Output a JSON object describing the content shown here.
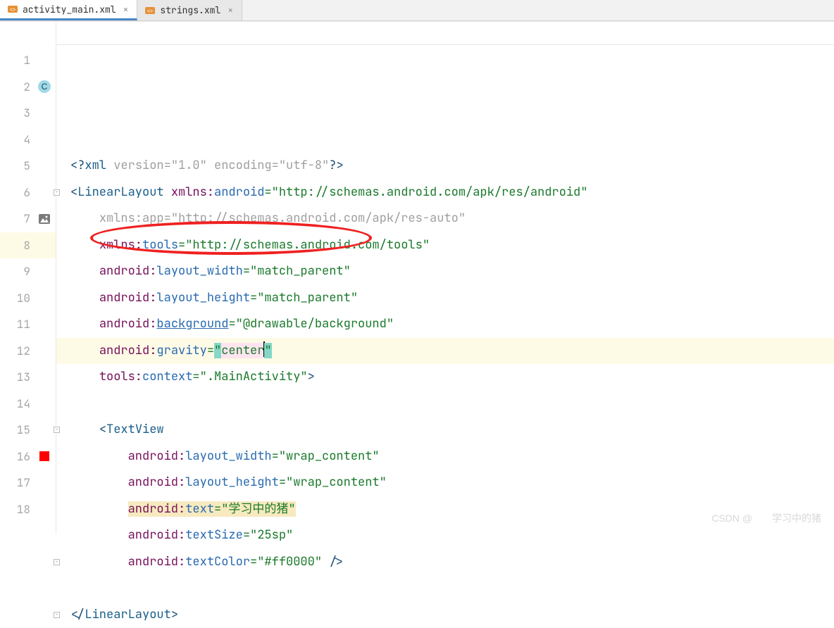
{
  "tabs": [
    {
      "label": "activity_main.xml",
      "active": true
    },
    {
      "label": "strings.xml",
      "active": false
    }
  ],
  "gutter": {
    "line_numbers": [
      "1",
      "2",
      "3",
      "4",
      "5",
      "6",
      "7",
      "8",
      "9",
      "10",
      "11",
      "12",
      "13",
      "14",
      "15",
      "16",
      "17",
      "18"
    ],
    "highlighted_line": 8,
    "icons": {
      "2": {
        "type": "circle-letter",
        "letter": "C",
        "bg": "#9fd9e8",
        "fg": "#245"
      },
      "7": {
        "type": "image-icon"
      },
      "16": {
        "type": "red-square"
      }
    }
  },
  "code": {
    "lines": [
      {
        "n": 1,
        "tokens": [
          {
            "t": "<?",
            "cls": "c-dark"
          },
          {
            "t": "xml ",
            "cls": "c-tag"
          },
          {
            "t": "version",
            "cls": "c-grey"
          },
          {
            "t": "=",
            "cls": "c-grey"
          },
          {
            "t": "\"1.0\"",
            "cls": "c-grey"
          },
          {
            "t": " ",
            "cls": ""
          },
          {
            "t": "encoding",
            "cls": "c-grey"
          },
          {
            "t": "=",
            "cls": "c-grey"
          },
          {
            "t": "\"utf-8\"",
            "cls": "c-grey"
          },
          {
            "t": "?>",
            "cls": "c-dark"
          }
        ]
      },
      {
        "n": 2,
        "fold": "open",
        "tokens": [
          {
            "t": "<",
            "cls": "c-dark"
          },
          {
            "t": "LinearLayout ",
            "cls": "c-tag"
          },
          {
            "t": "xmlns:",
            "cls": "c-attr-ns"
          },
          {
            "t": "android",
            "cls": "c-attr-name"
          },
          {
            "t": "=",
            "cls": "c-str"
          },
          {
            "t": "\"http://schemas.android.com/apk/res/android\"",
            "cls": "c-str"
          }
        ]
      },
      {
        "n": 3,
        "indent": "    ",
        "tokens": [
          {
            "t": "xmlns:",
            "cls": "c-grey"
          },
          {
            "t": "app",
            "cls": "c-grey"
          },
          {
            "t": "=",
            "cls": "c-grey"
          },
          {
            "t": "\"http://schemas.android.com/apk/res-auto\"",
            "cls": "c-grey"
          }
        ]
      },
      {
        "n": 4,
        "indent": "    ",
        "tokens": [
          {
            "t": "xmlns:",
            "cls": "c-attr-ns"
          },
          {
            "t": "tools",
            "cls": "c-attr-name"
          },
          {
            "t": "=",
            "cls": "c-str"
          },
          {
            "t": "\"http://schemas.android.com/tools\"",
            "cls": "c-str"
          }
        ]
      },
      {
        "n": 5,
        "indent": "    ",
        "tokens": [
          {
            "t": "android:",
            "cls": "c-attr-ns"
          },
          {
            "t": "layout_width",
            "cls": "c-attr-name"
          },
          {
            "t": "=",
            "cls": "c-str"
          },
          {
            "t": "\"match_parent\"",
            "cls": "c-str"
          }
        ]
      },
      {
        "n": 6,
        "indent": "    ",
        "tokens": [
          {
            "t": "android:",
            "cls": "c-attr-ns"
          },
          {
            "t": "layout_height",
            "cls": "c-attr-name"
          },
          {
            "t": "=",
            "cls": "c-str"
          },
          {
            "t": "\"match_parent\"",
            "cls": "c-str"
          }
        ]
      },
      {
        "n": 7,
        "indent": "    ",
        "tokens": [
          {
            "t": "android:",
            "cls": "c-attr-ns"
          },
          {
            "t": "background",
            "cls": "c-attr-name",
            "underline": true
          },
          {
            "t": "=",
            "cls": "c-str"
          },
          {
            "t": "\"@drawable/background\"",
            "cls": "c-str"
          }
        ]
      },
      {
        "n": 8,
        "indent": "    ",
        "hl": true,
        "tokens": [
          {
            "t": "android:",
            "cls": "c-attr-ns"
          },
          {
            "t": "gravity",
            "cls": "c-attr-name"
          },
          {
            "t": "=",
            "cls": "c-str"
          },
          {
            "t": "\"",
            "cls": "c-str",
            "bg": "sel-teal"
          },
          {
            "t": "center",
            "cls": "c-str",
            "bg": "sel-pink"
          },
          {
            "caret": true
          },
          {
            "t": "\"",
            "cls": "c-str",
            "bg": "sel-teal"
          }
        ]
      },
      {
        "n": 9,
        "indent": "    ",
        "tokens": [
          {
            "t": "tools:",
            "cls": "c-attr-ns"
          },
          {
            "t": "context",
            "cls": "c-attr-name"
          },
          {
            "t": "=",
            "cls": "c-str"
          },
          {
            "t": "\".MainActivity\"",
            "cls": "c-str"
          },
          {
            "t": ">",
            "cls": "c-dark"
          }
        ]
      },
      {
        "n": 10,
        "tokens": []
      },
      {
        "n": 11,
        "indent": "    ",
        "fold": "open",
        "tokens": [
          {
            "t": "<",
            "cls": "c-dark"
          },
          {
            "t": "TextView",
            "cls": "c-tag"
          }
        ]
      },
      {
        "n": 12,
        "indent": "        ",
        "tokens": [
          {
            "t": "android:",
            "cls": "c-attr-ns"
          },
          {
            "t": "layout_width",
            "cls": "c-attr-name"
          },
          {
            "t": "=",
            "cls": "c-str"
          },
          {
            "t": "\"wrap_content\"",
            "cls": "c-str"
          }
        ]
      },
      {
        "n": 13,
        "indent": "        ",
        "tokens": [
          {
            "t": "android:",
            "cls": "c-attr-ns"
          },
          {
            "t": "layout_height",
            "cls": "c-attr-name"
          },
          {
            "t": "=",
            "cls": "c-str"
          },
          {
            "t": "\"wrap_content\"",
            "cls": "c-str"
          }
        ]
      },
      {
        "n": 14,
        "indent": "        ",
        "tokens": [
          {
            "t": "android:",
            "cls": "c-attr-ns",
            "bg": "warn-bg"
          },
          {
            "t": "text",
            "cls": "c-attr-name",
            "bg": "warn-bg"
          },
          {
            "t": "=",
            "cls": "c-str",
            "bg": "warn-bg"
          },
          {
            "t": "\"学习中的猪\"",
            "cls": "c-str",
            "bg": "warn-bg"
          }
        ]
      },
      {
        "n": 15,
        "indent": "        ",
        "tokens": [
          {
            "t": "android:",
            "cls": "c-attr-ns"
          },
          {
            "t": "textSize",
            "cls": "c-attr-name"
          },
          {
            "t": "=",
            "cls": "c-str"
          },
          {
            "t": "\"25sp\"",
            "cls": "c-str"
          }
        ]
      },
      {
        "n": 16,
        "indent": "        ",
        "fold": "close",
        "tokens": [
          {
            "t": "android:",
            "cls": "c-attr-ns"
          },
          {
            "t": "textColor",
            "cls": "c-attr-name"
          },
          {
            "t": "=",
            "cls": "c-str"
          },
          {
            "t": "\"#ff0000\"",
            "cls": "c-str"
          },
          {
            "t": " />",
            "cls": "c-dark"
          }
        ]
      },
      {
        "n": 17,
        "tokens": []
      },
      {
        "n": 18,
        "fold": "close",
        "tokens": [
          {
            "t": "</",
            "cls": "c-dark"
          },
          {
            "t": "LinearLayout",
            "cls": "c-tag"
          },
          {
            "t": ">",
            "cls": "c-dark"
          }
        ]
      }
    ]
  },
  "annotation": {
    "ellipse": {
      "line": 8,
      "text": "android:gravity=\"center\""
    }
  },
  "watermark": "CSDN @  学习中的猪"
}
